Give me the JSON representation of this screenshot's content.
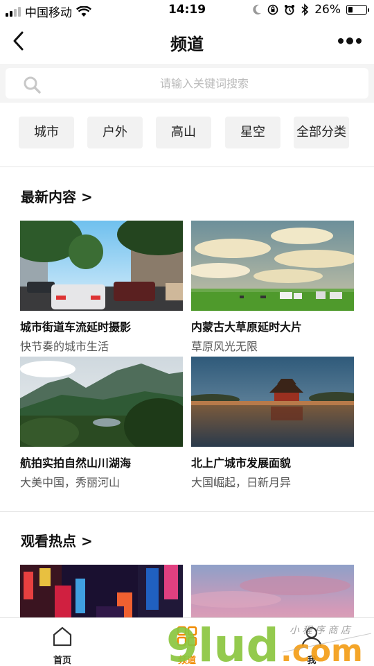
{
  "status_bar": {
    "carrier": "中国移动",
    "time": "14:19",
    "battery": "26%",
    "battery_level": 0.26
  },
  "nav": {
    "title": "频道",
    "back_icon": "chevron-left-icon",
    "more_icon": "more-dots-icon"
  },
  "search": {
    "placeholder": "请输入关键词搜索",
    "icon": "search-icon"
  },
  "categories": [
    "城市",
    "户外",
    "高山",
    "星空",
    "全部分类"
  ],
  "sections": [
    {
      "title": "最新内容 >",
      "items": [
        {
          "title": "城市街道车流延时摄影",
          "subtitle": "快节奏的城市生活"
        },
        {
          "title": "内蒙古大草原延时大片",
          "subtitle": "草原风光无限"
        },
        {
          "title": "航拍实拍自然山川湖海",
          "subtitle": "大美中国，秀丽河山"
        },
        {
          "title": "北上广城市发展面貌",
          "subtitle": "大国崛起，日新月异"
        }
      ]
    },
    {
      "title": "观看热点 >",
      "items": [
        {
          "title": "",
          "subtitle": ""
        },
        {
          "title": "",
          "subtitle": ""
        }
      ]
    }
  ],
  "tabbar": {
    "tabs": [
      {
        "label": "首页",
        "icon": "home-icon"
      },
      {
        "label": "频道",
        "icon": "grid-icon",
        "active": true
      },
      {
        "label": "我",
        "icon": "user-icon"
      }
    ]
  },
  "watermark": {
    "main": "9lud.com",
    "script": "小 程 序 商 店"
  },
  "colors": {
    "accent": "#f08a00",
    "divider": "#e6e6e6",
    "chip_bg": "#f2f2f2"
  }
}
